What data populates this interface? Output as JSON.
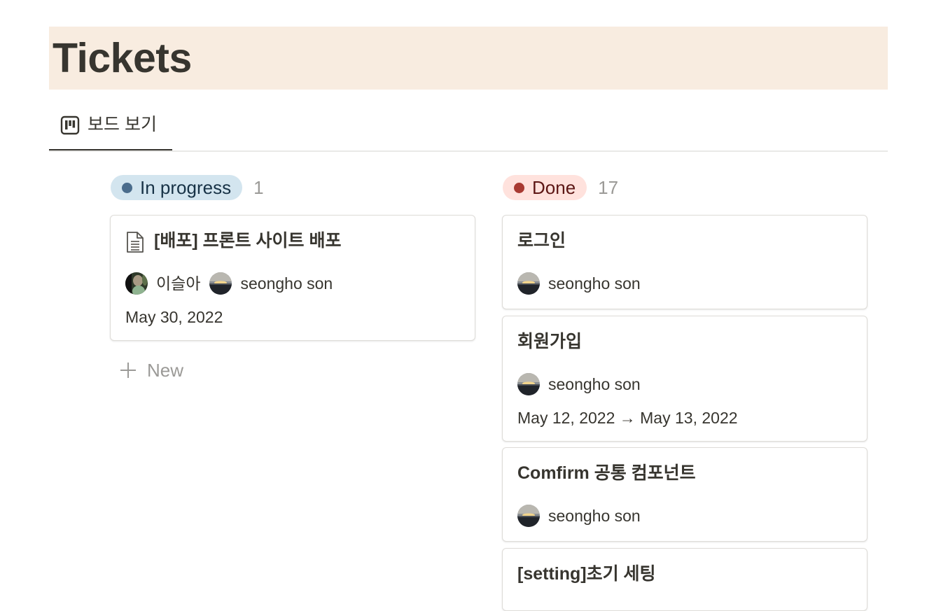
{
  "page": {
    "title": "Tickets",
    "banner_color": "#f8ece0"
  },
  "view_tab": {
    "icon": "board-icon",
    "label": "보드 보기"
  },
  "columns": [
    {
      "status": "In progress",
      "count": "1",
      "pill_bg": "#d3e5ef",
      "pill_text": "#183347",
      "dot_color": "#4a6c8c",
      "cards": [
        {
          "icon": "document-icon",
          "title": "[배포] 프론트 사이트 배포",
          "people": [
            "이슬아",
            "seongho son"
          ],
          "date": "May 30, 2022"
        }
      ],
      "new_label": "New"
    },
    {
      "status": "Done",
      "count": "17",
      "pill_bg": "#ffe2dd",
      "pill_text": "#5d1715",
      "dot_color": "#a83a32",
      "cards": [
        {
          "title": "로그인",
          "people": [
            "seongho son"
          ]
        },
        {
          "title": "회원가입",
          "people": [
            "seongho son"
          ],
          "date": "May 12, 2022 → May 13, 2022"
        },
        {
          "title": "Comfirm 공통 컴포넌트",
          "people": [
            "seongho son"
          ]
        },
        {
          "title": "[setting]초기 세팅"
        }
      ]
    }
  ]
}
